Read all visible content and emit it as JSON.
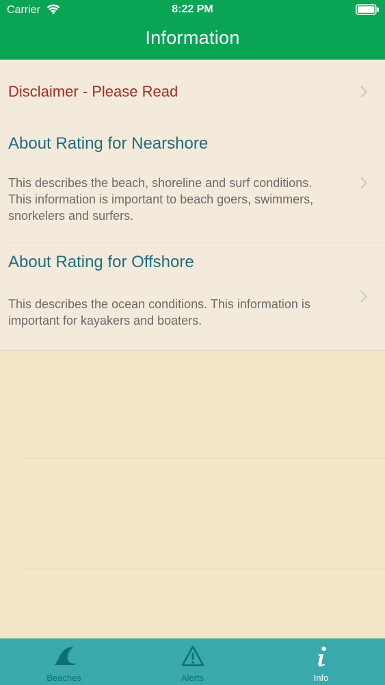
{
  "status_bar": {
    "carrier": "Carrier",
    "time": "8:22 PM"
  },
  "header": {
    "title": "Information"
  },
  "rows": [
    {
      "title": "Disclaimer - Please Read",
      "description": ""
    },
    {
      "title": "About Rating for Nearshore",
      "description": "This describes the beach, shoreline and surf conditions. This information is important to beach goers, swimmers, snorkelers and surfers."
    },
    {
      "title": "About Rating for Offshore",
      "description": "This describes the ocean conditions. This information is important for kayakers and boaters."
    }
  ],
  "tabs": [
    {
      "label": "Beaches",
      "icon": "wave-icon",
      "active": false
    },
    {
      "label": "Alerts",
      "icon": "warning-icon",
      "active": false
    },
    {
      "label": "Info",
      "icon": "info-icon",
      "active": true
    }
  ],
  "colors": {
    "header_bg": "#0aa455",
    "list_bg": "#f4eadb",
    "page_bg": "#f3e6c4",
    "title_teal": "#1e6c80",
    "title_red": "#a52a2a",
    "tabbar_bg": "#39a9ad"
  }
}
